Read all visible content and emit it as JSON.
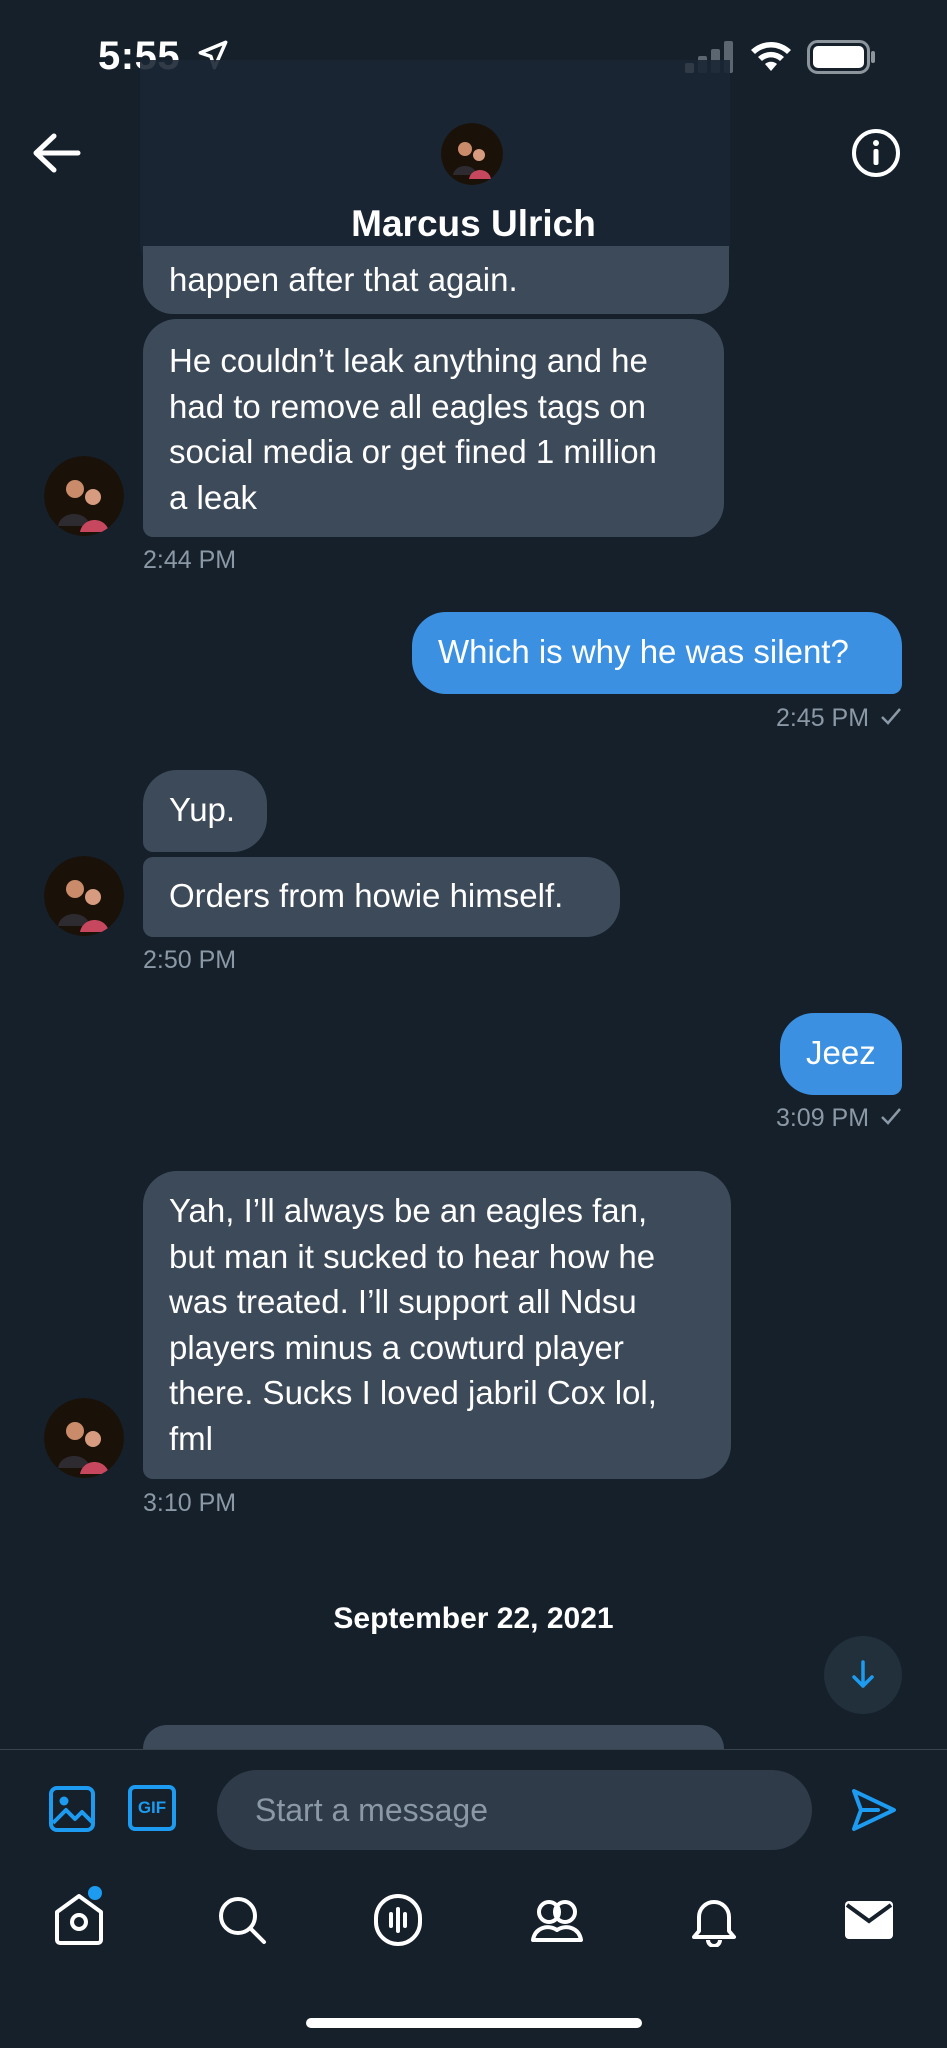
{
  "status_bar": {
    "time": "5:55"
  },
  "header": {
    "name": "Marcus Ulrich"
  },
  "messages": [
    {
      "text_lines": [
        "happen after that again."
      ]
    },
    {
      "text_lines": [
        "He couldn’t leak anything and he",
        "had to remove all eagles tags on",
        "social media or get fined 1 million",
        "a leak"
      ],
      "time": "2:44 PM"
    },
    {
      "text": "Which is why he was silent?",
      "time": "2:45 PM"
    },
    {
      "text": "Yup."
    },
    {
      "text": "Orders from howie himself.",
      "time": "2:50 PM"
    },
    {
      "text": "Jeez",
      "time": "3:09 PM"
    },
    {
      "text_lines": [
        "Yah, I’ll always be an eagles fan,",
        "but man it sucked to hear how he",
        "was treated. I’ll support all Ndsu",
        "players minus a cowturd player",
        "there. Sucks I loved jabril Cox lol,",
        "fml"
      ],
      "time": "3:10 PM"
    }
  ],
  "date_separator": "September 22, 2021",
  "composer": {
    "placeholder": "Start a message",
    "gif_label": "GIF"
  },
  "colors": {
    "background": "#15202b",
    "accent": "#1d9bf0",
    "incoming_bubble": "#3d4a5a",
    "outgoing_bubble": "#3b90e1"
  },
  "icons": {
    "header": [
      "back-arrow-icon",
      "info-icon"
    ],
    "composer": [
      "image-icon",
      "gif-icon",
      "send-icon"
    ],
    "tabbar": [
      "home-icon",
      "search-icon",
      "spaces-icon",
      "communities-icon",
      "notifications-icon",
      "messages-icon"
    ]
  }
}
